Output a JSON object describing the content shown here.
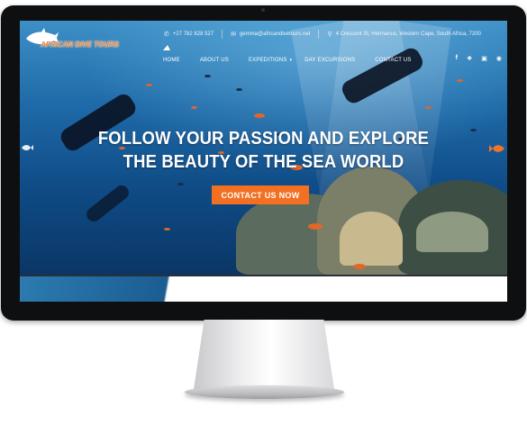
{
  "brand": {
    "name": "AFRICAN DIVE TOURS",
    "accent": "#f36f21"
  },
  "contact": {
    "phone": "+27 782 828 527",
    "email": "gemma@africandivetours.net",
    "address": "4 Crescent St, Hermanus, Western Cape, South Africa, 7200",
    "phone_icon": "phone-icon",
    "email_icon": "envelope-icon",
    "address_icon": "map-pin-icon"
  },
  "nav": {
    "items": [
      {
        "label": "HOME"
      },
      {
        "label": "ABOUT US"
      },
      {
        "label": "EXPEDITIONS"
      },
      {
        "label": "DAY EXCURSIONS"
      },
      {
        "label": "CONTACT US"
      }
    ]
  },
  "social": {
    "icons": [
      "facebook-icon",
      "twitter-icon",
      "instagram-icon",
      "tripadvisor-icon"
    ]
  },
  "hero": {
    "title_line1": "FOLLOW YOUR PASSION AND EXPLORE",
    "title_line2": "THE BEAUTY OF THE SEA WORLD",
    "cta_label": "CONTACT US NOW"
  }
}
